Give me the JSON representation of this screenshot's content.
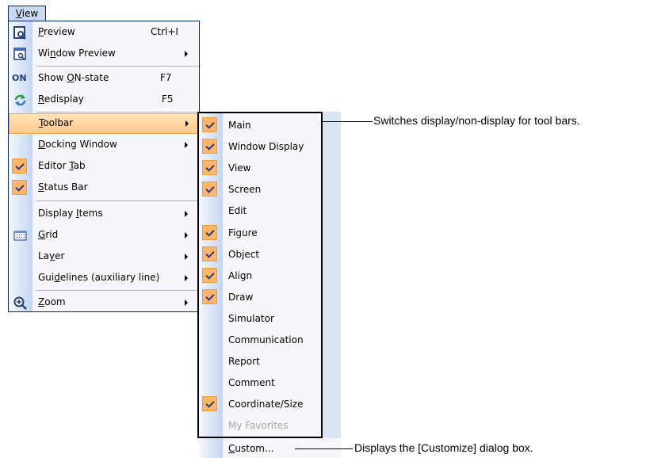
{
  "menu_bar": {
    "title": "View",
    "title_mnemonic": "V",
    "title_rest": "iew"
  },
  "menu": {
    "items": [
      {
        "pre": "",
        "mn": "P",
        "post": "review",
        "shortcut": "Ctrl+I",
        "icon": "preview-icon"
      },
      {
        "pre": "Wi",
        "mn": "n",
        "post": "dow Preview",
        "submenu": true,
        "icon": "window-preview-icon"
      },
      {
        "pre": "Show ",
        "mn": "O",
        "post": "N-state",
        "shortcut": "F7",
        "icon": "on-state-icon",
        "icon_text": "ON"
      },
      {
        "pre": "",
        "mn": "R",
        "post": "edisplay",
        "shortcut": "F5",
        "icon": "redisplay-icon"
      },
      {
        "pre": "",
        "mn": "T",
        "post": "oolbar",
        "submenu": true,
        "highlighted": true
      },
      {
        "pre": "",
        "mn": "D",
        "post": "ocking Window",
        "submenu": true
      },
      {
        "pre": "Editor ",
        "mn": "T",
        "post": "ab",
        "checked": true
      },
      {
        "pre": "",
        "mn": "S",
        "post": "tatus Bar",
        "checked": true
      },
      {
        "pre": "Display ",
        "mn": "I",
        "post": "tems",
        "submenu": true
      },
      {
        "pre": "",
        "mn": "G",
        "post": "rid",
        "submenu": true,
        "icon": "grid-icon"
      },
      {
        "pre": "La",
        "mn": "y",
        "post": "er",
        "submenu": true
      },
      {
        "pre": "Gui",
        "mn": "d",
        "post": "elines (auxiliary line)",
        "submenu": true
      },
      {
        "pre": "",
        "mn": "Z",
        "post": "oom",
        "submenu": true,
        "icon": "zoom-icon"
      }
    ]
  },
  "toolbar_submenu": {
    "items": [
      {
        "label": "Main",
        "checked": true
      },
      {
        "label": "Window Display",
        "checked": true
      },
      {
        "label": "View",
        "checked": true
      },
      {
        "label": "Screen",
        "checked": true
      },
      {
        "label": "Edit",
        "checked": false
      },
      {
        "label": "Figure",
        "checked": true
      },
      {
        "label": "Object",
        "checked": true
      },
      {
        "label": "Align",
        "checked": true
      },
      {
        "label": "Draw",
        "checked": true
      },
      {
        "label": "Simulator",
        "checked": false
      },
      {
        "label": "Communication",
        "checked": false
      },
      {
        "label": "Report",
        "checked": false
      },
      {
        "label": "Comment",
        "checked": false
      },
      {
        "label": "Coordinate/Size",
        "checked": true
      },
      {
        "label": "My Favorites",
        "checked": false,
        "disabled": true
      }
    ],
    "custom": {
      "mn": "C",
      "post": "ustom..."
    }
  },
  "annotations": {
    "toolbars": "Switches display/non-display for tool bars.",
    "customize": "Displays the [Customize] dialog box."
  },
  "colors": {
    "highlight": "#ffc98c",
    "check_bg": "#ffb56a",
    "border": "#0a246a"
  }
}
